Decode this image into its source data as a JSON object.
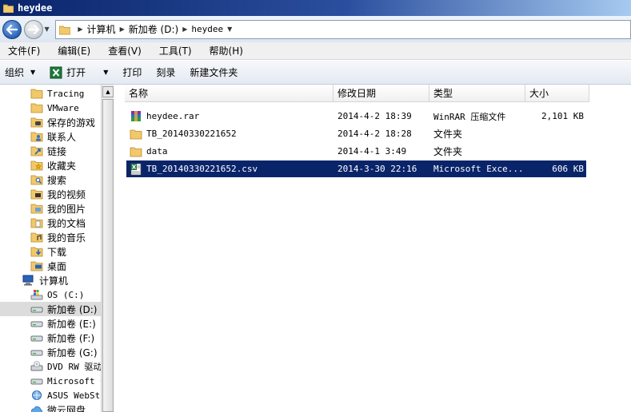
{
  "window": {
    "title": "heydee"
  },
  "breadcrumbs": [
    "计算机",
    "新加卷 (D:)",
    "heydee"
  ],
  "menu": [
    "文件(F)",
    "编辑(E)",
    "查看(V)",
    "工具(T)",
    "帮助(H)"
  ],
  "commands": {
    "organize": "组织",
    "open": "打开",
    "print": "打印",
    "burn": "刻录",
    "new_folder": "新建文件夹"
  },
  "sidebar": {
    "items": [
      {
        "label": "Tracing",
        "icon": "folder-icon"
      },
      {
        "label": "VMware",
        "icon": "folder-icon"
      },
      {
        "label": "保存的游戏",
        "icon": "saved-games-icon"
      },
      {
        "label": "联系人",
        "icon": "contacts-icon"
      },
      {
        "label": "链接",
        "icon": "links-icon"
      },
      {
        "label": "收藏夹",
        "icon": "favorites-icon"
      },
      {
        "label": "搜索",
        "icon": "search-icon"
      },
      {
        "label": "我的视频",
        "icon": "videos-icon"
      },
      {
        "label": "我的图片",
        "icon": "pictures-icon"
      },
      {
        "label": "我的文档",
        "icon": "documents-icon"
      },
      {
        "label": "我的音乐",
        "icon": "music-icon"
      },
      {
        "label": "下载",
        "icon": "downloads-icon"
      },
      {
        "label": "桌面",
        "icon": "desktop-icon"
      },
      {
        "label": "计算机",
        "icon": "computer-icon"
      },
      {
        "label": "OS (C:)",
        "icon": "windows-drive-icon"
      },
      {
        "label": "新加卷 (D:)",
        "icon": "drive-icon",
        "selected": true
      },
      {
        "label": "新加卷 (E:)",
        "icon": "drive-icon"
      },
      {
        "label": "新加卷 (F:)",
        "icon": "drive-icon"
      },
      {
        "label": "新加卷 (G:)",
        "icon": "drive-icon"
      },
      {
        "label": "DVD RW 驱动",
        "icon": "dvd-drive-icon"
      },
      {
        "label": "Microsoft O",
        "icon": "drive-icon"
      },
      {
        "label": "ASUS WebSto",
        "icon": "network-icon"
      },
      {
        "label": "微云网盘",
        "icon": "cloud-icon"
      }
    ]
  },
  "columns": {
    "name": "名称",
    "date": "修改日期",
    "type": "类型",
    "size": "大小"
  },
  "files": [
    {
      "name": "heydee.rar",
      "date": "2014-4-2 18:39",
      "type": "WinRAR 压缩文件",
      "size": "2,101 KB",
      "icon": "rar-icon"
    },
    {
      "name": "TB_20140330221652",
      "date": "2014-4-2 18:28",
      "type": "文件夹",
      "size": "",
      "icon": "folder-icon"
    },
    {
      "name": "data",
      "date": "2014-4-1 3:49",
      "type": "文件夹",
      "size": "",
      "icon": "folder-icon"
    },
    {
      "name": "TB_20140330221652.csv",
      "date": "2014-3-30 22:16",
      "type": "Microsoft Exce...",
      "size": "606 KB",
      "icon": "csv-icon",
      "selected": true
    }
  ],
  "colors": {
    "titlebar": "#0a246a",
    "selection": "#0a246a",
    "folder": "#f2c96a"
  }
}
